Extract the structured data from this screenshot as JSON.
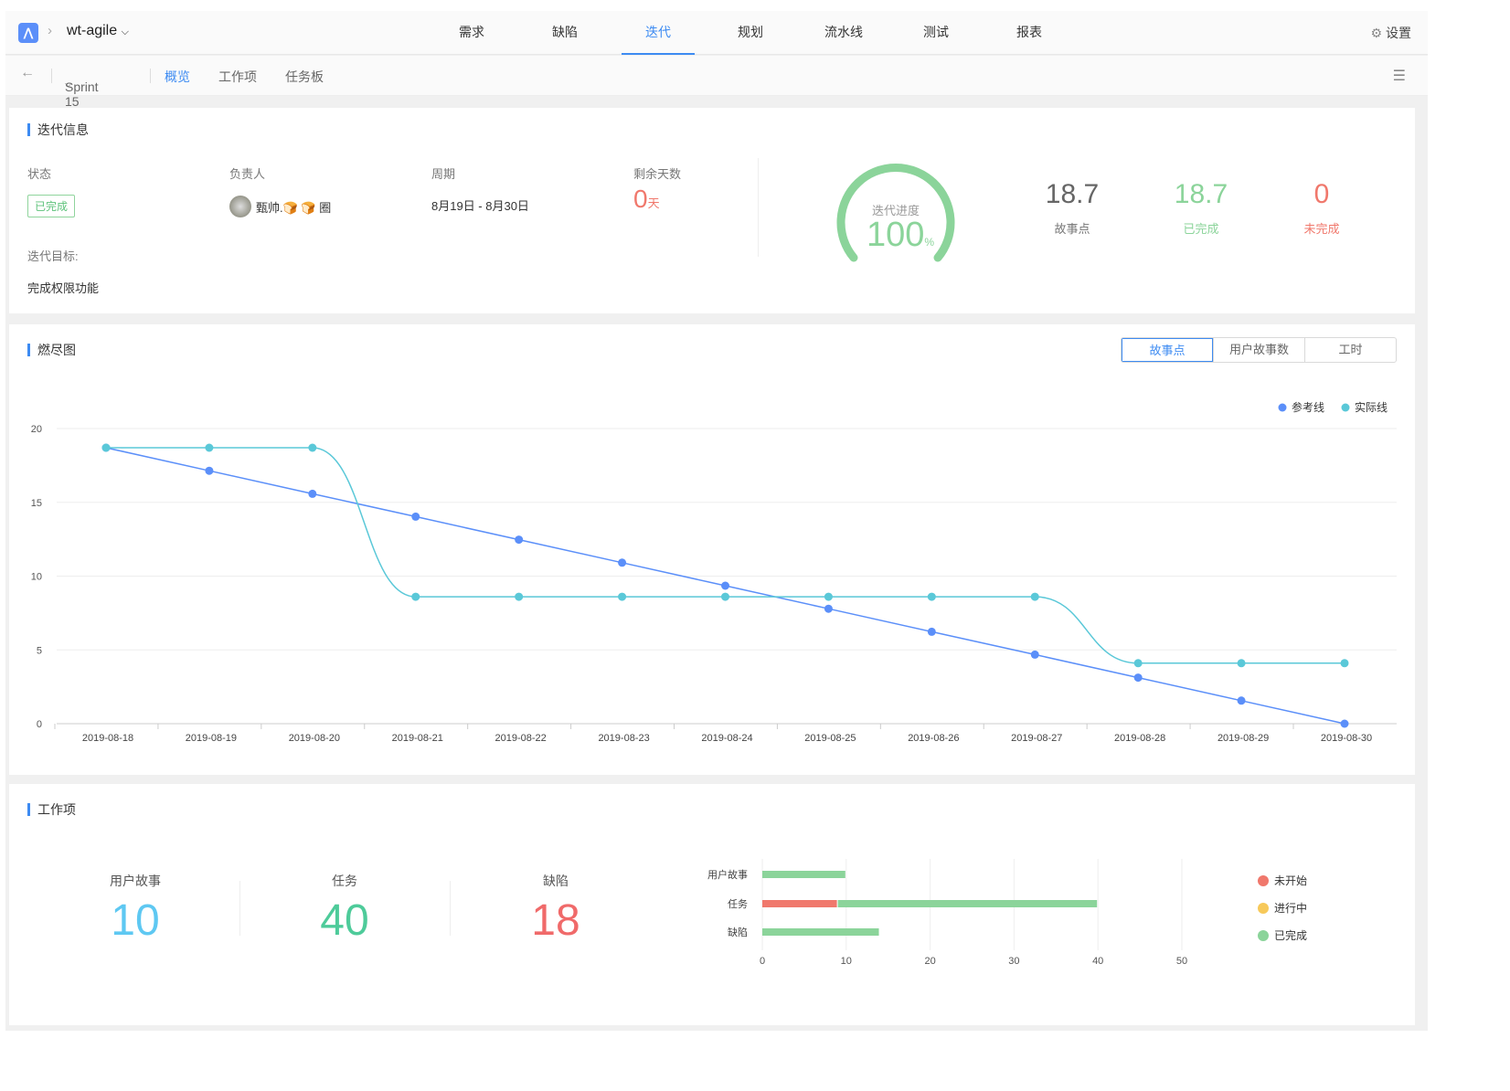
{
  "header": {
    "project": "wt-agile",
    "nav": [
      "需求",
      "缺陷",
      "迭代",
      "规划",
      "流水线",
      "测试",
      "报表"
    ],
    "active_nav": "迭代",
    "settings": "设置"
  },
  "subnav": {
    "sprint": "Sprint 15",
    "tabs": [
      "概览",
      "工作项",
      "任务板"
    ],
    "active_tab": "概览"
  },
  "info": {
    "title": "迭代信息",
    "status_label": "状态",
    "status": "已完成",
    "owner_label": "负责人",
    "owner": "甄帅.🍞 🍞 圈",
    "period_label": "周期",
    "period": "8月19日 - 8月30日",
    "remaining_label": "剩余天数",
    "remaining": "0",
    "remaining_unit": "天",
    "goal_label": "迭代目标:",
    "goal": "完成权限功能",
    "progress_label": "迭代进度",
    "progress": "100",
    "progress_unit": "%",
    "progress_fraction": 1.0,
    "story_points": "18.7",
    "story_points_label": "故事点",
    "done": "18.7",
    "done_label": "已完成",
    "undone": "0",
    "undone_label": "未完成"
  },
  "burndown": {
    "title": "燃尽图",
    "toggles": [
      "故事点",
      "用户故事数",
      "工时"
    ],
    "active_toggle": "故事点"
  },
  "workitems": {
    "title": "工作项",
    "items": [
      {
        "label": "用户故事",
        "count": "10",
        "color": "#5ec8f2"
      },
      {
        "label": "任务",
        "count": "40",
        "color": "#4ecb9a"
      },
      {
        "label": "缺陷",
        "count": "18",
        "color": "#f06a6a"
      }
    ]
  },
  "colors": {
    "accent": "#3d8bf2",
    "green": "#8bd49a",
    "red": "#f0786c",
    "yellow": "#f7c95a",
    "ref": "#5b8ff9",
    "actual": "#5ac8d8"
  },
  "chart_data": [
    {
      "type": "line",
      "title": "燃尽图",
      "x": [
        "2019-08-18",
        "2019-08-19",
        "2019-08-20",
        "2019-08-21",
        "2019-08-22",
        "2019-08-23",
        "2019-08-24",
        "2019-08-25",
        "2019-08-26",
        "2019-08-27",
        "2019-08-28",
        "2019-08-29",
        "2019-08-30"
      ],
      "ylim": [
        0,
        20
      ],
      "yticks": [
        "0",
        "5",
        "10",
        "15",
        "20"
      ],
      "legend": "top-right",
      "series": [
        {
          "name": "参考线",
          "values": [
            18.7,
            17.14,
            15.58,
            14.03,
            12.47,
            10.91,
            9.35,
            7.79,
            6.23,
            4.68,
            3.12,
            1.56,
            0
          ]
        },
        {
          "name": "实际线",
          "values": [
            18.7,
            18.7,
            18.7,
            8.6,
            8.6,
            8.6,
            8.6,
            8.6,
            8.6,
            8.6,
            4.1,
            4.1,
            4.1
          ]
        }
      ]
    },
    {
      "type": "bar",
      "stacked": true,
      "orientation": "horizontal",
      "categories": [
        "用户故事",
        "任务",
        "缺陷"
      ],
      "xlim": [
        0,
        50
      ],
      "xticks": [
        "0",
        "10",
        "20",
        "30",
        "40",
        "50"
      ],
      "legend": "right",
      "series": [
        {
          "name": "未开始",
          "values": [
            0,
            9,
            0
          ]
        },
        {
          "name": "进行中",
          "values": [
            0,
            0,
            0
          ]
        },
        {
          "name": "已完成",
          "values": [
            10,
            31,
            14
          ]
        }
      ]
    }
  ]
}
